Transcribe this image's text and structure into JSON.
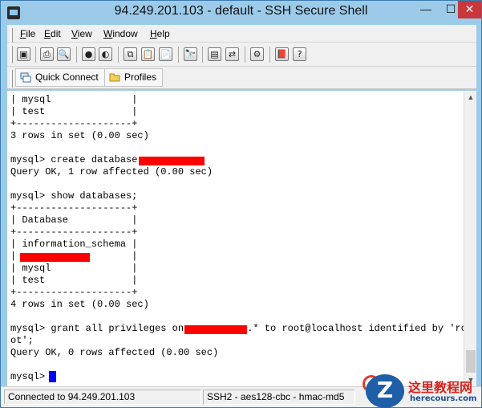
{
  "window": {
    "title": "94.249.201.103 - default - SSH Secure Shell",
    "min_symbol": "—",
    "max_symbol": "☐",
    "close_symbol": "✕"
  },
  "menu": {
    "items": [
      {
        "label": "File",
        "underline": "F"
      },
      {
        "label": "Edit",
        "underline": "E"
      },
      {
        "label": "View",
        "underline": "V"
      },
      {
        "label": "Window",
        "underline": "W"
      },
      {
        "label": "Help",
        "underline": "H"
      }
    ]
  },
  "toolbar": {
    "icons": [
      {
        "name": "save-icon",
        "glyph": "▣"
      },
      {
        "name": "print-icon",
        "glyph": "⎙"
      },
      {
        "name": "print-preview-icon",
        "glyph": "🔍"
      },
      {
        "name": "disconnect-icon",
        "glyph": "●"
      },
      {
        "name": "connect-icon",
        "glyph": "◐"
      },
      {
        "name": "copy-icon",
        "glyph": "⧉"
      },
      {
        "name": "paste-icon",
        "glyph": "📋"
      },
      {
        "name": "paste-special-icon",
        "glyph": "📄"
      },
      {
        "name": "find-icon",
        "glyph": "🔭"
      },
      {
        "name": "new-terminal-icon",
        "glyph": "▤"
      },
      {
        "name": "file-transfer-icon",
        "glyph": "⇄"
      },
      {
        "name": "settings-icon",
        "glyph": "⚙"
      },
      {
        "name": "help-book-icon",
        "glyph": "📕"
      },
      {
        "name": "context-help-icon",
        "glyph": "?"
      }
    ]
  },
  "quickbar": {
    "quick_connect_label": "Quick Connect",
    "profiles_label": "Profiles"
  },
  "terminal": {
    "lines": [
      "| mysql              |",
      "| test               |",
      "+--------------------+",
      "3 rows in set (0.00 sec)",
      "",
      "mysql> create database ",
      "Query OK, 1 row affected (0.00 sec)",
      "",
      "mysql> show databases;",
      "+--------------------+",
      "| Database           |",
      "+--------------------+",
      "| information_schema |",
      "|                    |",
      "| mysql              |",
      "| test               |",
      "+--------------------+",
      "4 rows in set (0.00 sec)",
      "",
      "mysql> grant all privileges on           .* to root@localhost identified by 'ro",
      "ot';",
      "Query OK, 0 rows affected (0.00 sec)",
      "",
      "mysql> "
    ]
  },
  "status": {
    "connection": "Connected to 94.249.201.103",
    "cipher": "SSH2 - aes128-cbc - hmac-md5"
  },
  "watermark": {
    "logo_letter": "Z",
    "title": "这里教程网",
    "url": "herecours.com"
  },
  "colors": {
    "title_bar": "#9ccbea",
    "close_button": "#c7373c",
    "redaction": "#ff0000",
    "cursor": "#0000ff"
  }
}
